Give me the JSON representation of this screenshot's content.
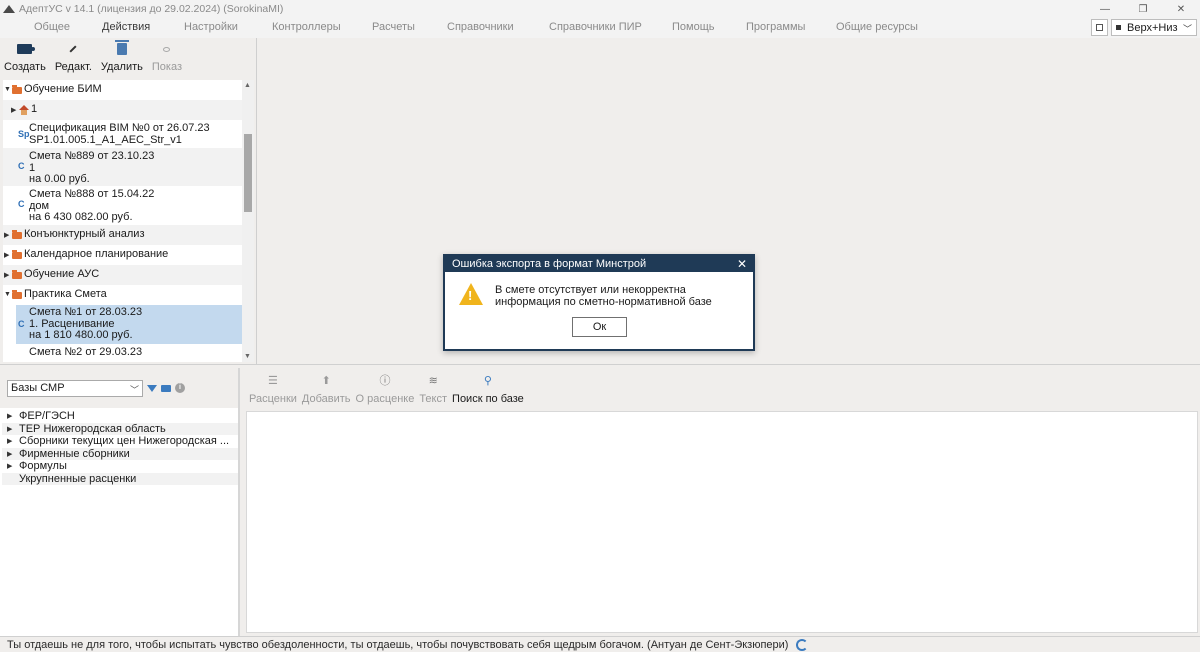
{
  "window": {
    "title": "АдептУС v 14.1 (лицензия до 29.02.2024) (SorokinaMI)",
    "controls": [
      "minimize",
      "restore",
      "close"
    ]
  },
  "menu": {
    "items": [
      "Общее",
      "Действия",
      "Настройки",
      "Контроллеры",
      "Расчеты",
      "Справочники",
      "Справочники ПИР",
      "Помощь",
      "Программы",
      "Общие ресурсы"
    ],
    "active": "Действия",
    "layout_select": "Верх+Низ"
  },
  "left_toolbar": {
    "create": "Создать",
    "edit": "Редакт.",
    "delete": "Удалить",
    "show": "Показ"
  },
  "tree": [
    {
      "text": "Обучение БИМ",
      "kind": "folder",
      "expanded": true
    },
    {
      "text": "1",
      "kind": "house",
      "expanded": false
    },
    {
      "text": "Спецификация BIM №0 от 26.07.23\nSP1.01.005.1_A1_AEC_Str_v1",
      "kind": "doc"
    },
    {
      "text": "Смета №889 от 23.10.23\n1\nна 0.00 руб.",
      "kind": "doc"
    },
    {
      "text": "Смета №888 от 15.04.22\nдом\nна 6 430 082.00 руб.",
      "kind": "doc"
    },
    {
      "text": "Конъюнктурный анализ",
      "kind": "folder",
      "expanded": false
    },
    {
      "text": "Календарное планирование",
      "kind": "folder",
      "expanded": false
    },
    {
      "text": "Обучение АУС",
      "kind": "folder",
      "expanded": false
    },
    {
      "text": "Практика Смета",
      "kind": "folder",
      "expanded": true
    },
    {
      "text": "Смета №1 от 28.03.23\n1. Расценивание\nна 1 810 480.00 руб.",
      "kind": "doc",
      "selected": true
    },
    {
      "text": "Смета №2 от 29.03.23",
      "kind": "doc"
    }
  ],
  "bases": {
    "select": "Базы СМР",
    "items": [
      "ФЕР/ГЭСН",
      "ТЕР Нижегородская область",
      "Сборники текущих цен Нижегородская ...",
      "Фирменные сборники",
      "Формулы",
      "Укрупненные расценки"
    ]
  },
  "right_toolbar": {
    "rates": "Расценки",
    "add": "Добавить",
    "about_rate": "О расценке",
    "text": "Текст",
    "search_base": "Поиск по базе"
  },
  "dialog": {
    "title": "Ошибка экспорта в формат Минстрой",
    "message": "В смете отсутствует или некорректна информация по сметно-нормативной базе",
    "ok": "Ок"
  },
  "status": {
    "quote": "Ты отдаешь не для того, чтобы испытать чувство обездоленности, ты отдаешь, чтобы почувствовать себя щедрым богачом. (Антуан де Сент-Экзюпери)"
  },
  "colors": {
    "dialog_header": "#1f3a56",
    "selection": "#c3d9ee",
    "folder": "#e07030",
    "warning": "#f0b41c"
  }
}
